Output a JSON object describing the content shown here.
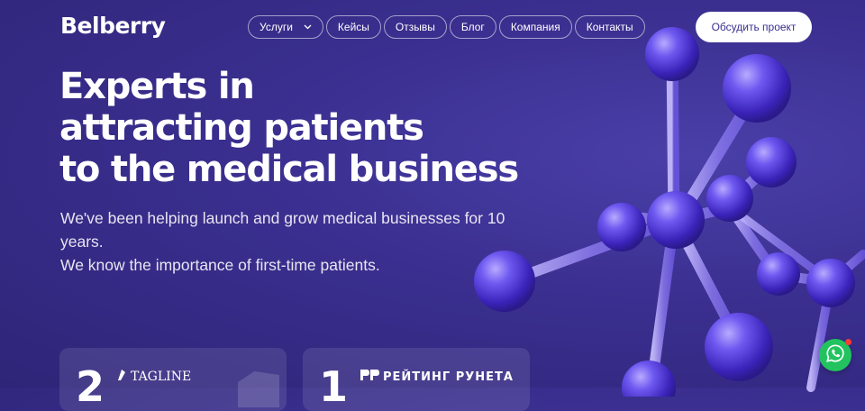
{
  "header": {
    "logo_text": "Belberry",
    "nav": [
      {
        "label": "Услуги",
        "has_dropdown": true
      },
      {
        "label": "Кейсы"
      },
      {
        "label": "Отзывы"
      },
      {
        "label": "Блог"
      },
      {
        "label": "Компания"
      },
      {
        "label": "Контакты"
      }
    ],
    "cta_label": "Обсудить проект"
  },
  "hero": {
    "title_lines": [
      "Experts in",
      "attracting patients",
      "to the medical business"
    ],
    "subtitle_lines": [
      "We've been helping launch and grow medical businesses for 10 years.",
      "We know the importance of first-time patients."
    ]
  },
  "cards": [
    {
      "number": "2",
      "label": "TAGLINE"
    },
    {
      "number": "1",
      "label": "РЕЙТИНГ РУНЕТА"
    }
  ],
  "icons": {
    "dropdown": "chevron-down-icon",
    "tagline": "tagline-logo-icon",
    "rating": "rr-logo-icon",
    "chat": "whatsapp-icon"
  },
  "colors": {
    "background": "#3a2f8f",
    "cta_text": "#3b2f8f",
    "whatsapp": "#22c35e",
    "molecule": "#5a47e0"
  }
}
